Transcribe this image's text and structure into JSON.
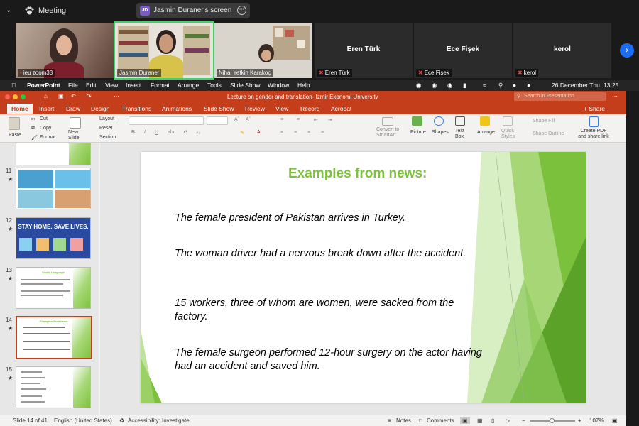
{
  "zoom": {
    "meeting_label": "Meeting",
    "screen_share_label": "Jasmin Duraner's screen",
    "screen_share_initials": "JD",
    "participants": [
      {
        "name": "ieu zoom33",
        "muted": false
      },
      {
        "name": "Jasmin Duraner",
        "muted": false
      },
      {
        "name": "Nihal Yetkin Karakoç",
        "muted": false
      },
      {
        "name": "Eren Türk",
        "muted": true,
        "display": "Eren Türk"
      },
      {
        "name": "Ece Fişek",
        "muted": true,
        "display": "Ece Fişek"
      },
      {
        "name": "kerol",
        "muted": true,
        "display": "kerol"
      }
    ]
  },
  "macos": {
    "app": "PowerPoint",
    "menus": [
      "File",
      "Edit",
      "View",
      "Insert",
      "Format",
      "Arrange",
      "Tools",
      "Slide Show",
      "Window",
      "Help"
    ],
    "date": "26 December Thu",
    "time": "13:25"
  },
  "ppt": {
    "doc_title": "Lecture on gender and translation- Izmir Ekonomi University",
    "search_placeholder": "Search in Presentation",
    "share_label": "Share",
    "tabs": [
      "Home",
      "Insert",
      "Draw",
      "Design",
      "Transitions",
      "Animations",
      "Slide Show",
      "Review",
      "View",
      "Record",
      "Acrobat"
    ],
    "ribbon": {
      "paste": "Paste",
      "cut": "Cut",
      "copy": "Copy",
      "format": "Format",
      "new_slide": "New Slide",
      "layout": "Layout",
      "reset": "Reset",
      "section": "Section",
      "convert_smartart": "Convert to SmartArt",
      "picture": "Picture",
      "shapes": "Shapes",
      "text_box": "Text Box",
      "arrange": "Arrange",
      "quick_styles": "Quick Styles",
      "shape_fill": "Shape Fill",
      "shape_outline": "Shape Outline",
      "create_pdf": "Create PDF and share link"
    },
    "thumbnails": [
      {
        "num": "11",
        "title": ""
      },
      {
        "num": "12",
        "title": "STAY HOME. SAVE LIVES."
      },
      {
        "num": "13",
        "title": "Sexist Language"
      },
      {
        "num": "14",
        "title": "Examples from news:"
      },
      {
        "num": "15",
        "title": ""
      }
    ],
    "slide": {
      "title": "Examples from news:",
      "lines": [
        "The female president of Pakistan arrives in Turkey.",
        "The woman driver had a nervous break down after the accident.",
        "15 workers, three of whom are women, were sacked from the factory.",
        "The female surgeon performed 12-hour surgery on the actor having had an accident and saved him."
      ]
    },
    "status": {
      "slide_count": "Slide 14 of 41",
      "language": "English (United States)",
      "accessibility": "Accessibility: Investigate",
      "notes": "Notes",
      "comments": "Comments",
      "zoom": "107%"
    },
    "colors": {
      "accent": "#c43e1c",
      "slide_green": "#7cc13b"
    }
  }
}
